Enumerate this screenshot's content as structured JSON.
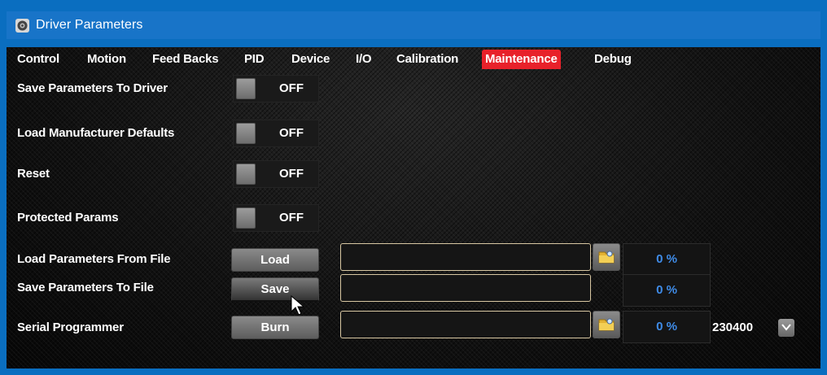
{
  "window": {
    "title": "Driver Parameters",
    "icon": "gear-icon"
  },
  "tabs": [
    {
      "label": "Control",
      "active": false
    },
    {
      "label": "Motion",
      "active": false
    },
    {
      "label": "Feed Backs",
      "active": false
    },
    {
      "label": "PID",
      "active": false
    },
    {
      "label": "Device",
      "active": false
    },
    {
      "label": "I/O",
      "active": false
    },
    {
      "label": "Calibration",
      "active": false
    },
    {
      "label": "Maintenance",
      "active": true
    },
    {
      "label": "Debug",
      "active": false
    }
  ],
  "toggles": [
    {
      "label": "Save Parameters To Driver",
      "state": "OFF"
    },
    {
      "label": "Load Manufacturer Defaults",
      "state": "OFF"
    },
    {
      "label": "Reset",
      "state": "OFF"
    },
    {
      "label": "Protected Params",
      "state": "OFF"
    }
  ],
  "file_rows": [
    {
      "label": "Load Parameters From File",
      "button": "Load",
      "path": "",
      "progress": "0 %"
    },
    {
      "label": "Save Parameters To File",
      "button": "Save",
      "path": "",
      "progress": "0 %"
    },
    {
      "label": "Serial Programmer",
      "button": "Burn",
      "path": "",
      "progress": "0  %"
    }
  ],
  "serial": {
    "baud_rate": "230400"
  },
  "colors": {
    "titlebar": "#1874c8",
    "active_tab": "#e8212a",
    "progress_text": "#3f8ce8",
    "path_border": "#d8c7a2"
  }
}
